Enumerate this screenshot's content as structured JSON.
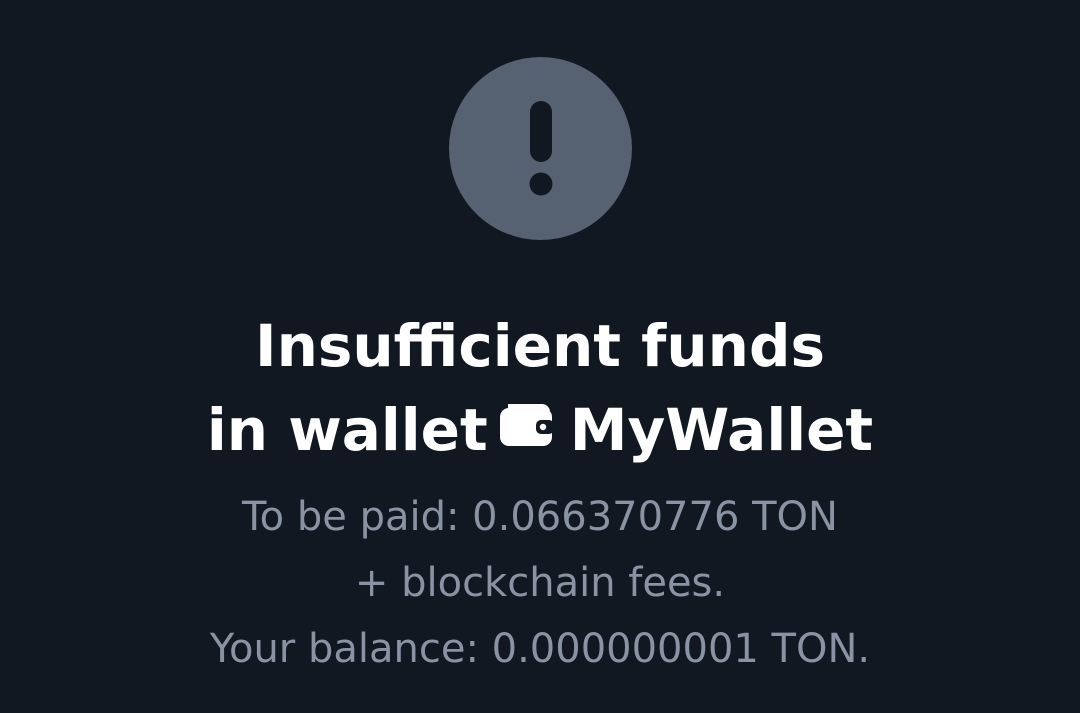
{
  "alert": {
    "icon": "exclamation-icon",
    "circle_color": "#566171",
    "glyph_color": "#121821"
  },
  "title": {
    "line1": "Insufficient funds",
    "line2_prefix": "in wallet",
    "wallet_icon": "wallet-icon",
    "wallet_name": "MyWallet"
  },
  "details": {
    "to_be_paid": "To be paid: 0.066370776 TON",
    "fees": "+ blockchain fees.",
    "balance": "Your balance: 0.000000001 TON."
  },
  "colors": {
    "background": "#121821",
    "title": "#ffffff",
    "secondary_text": "#8993a3"
  }
}
